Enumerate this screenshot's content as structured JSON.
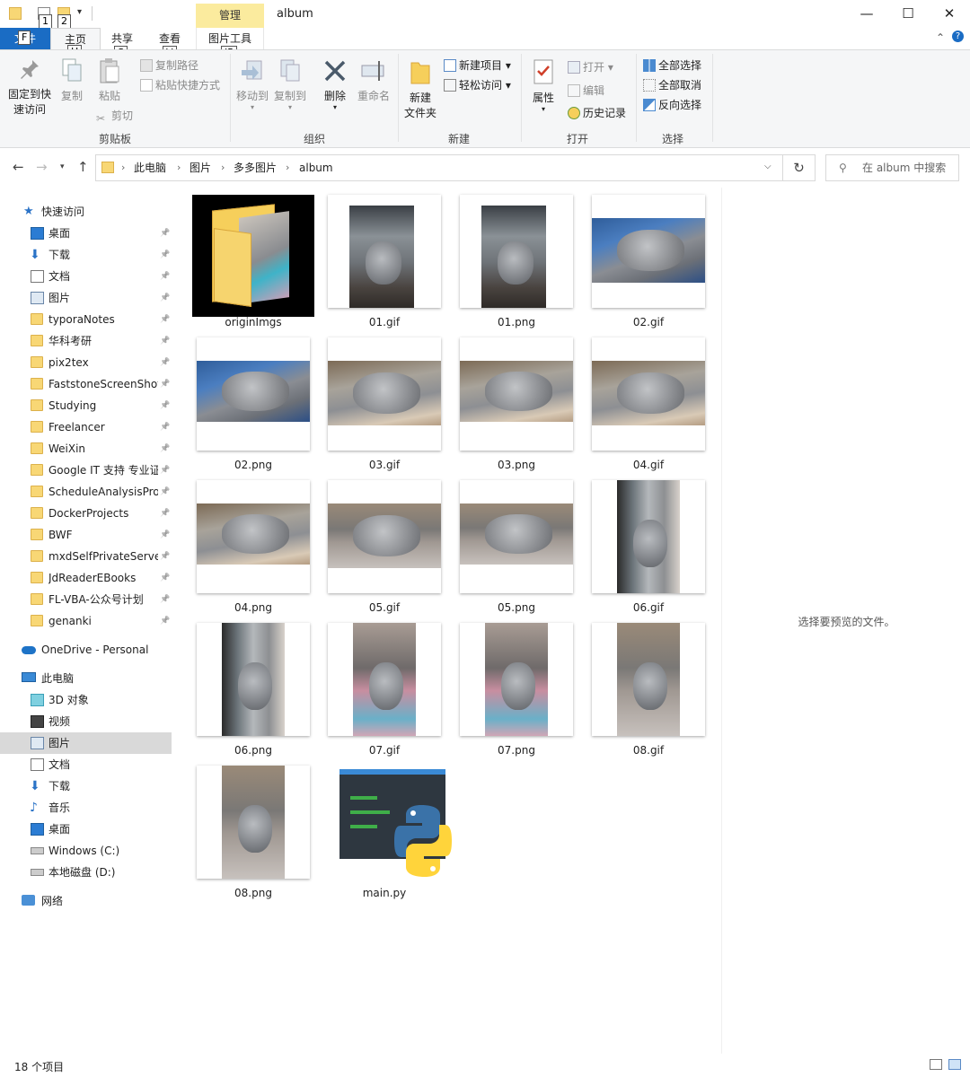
{
  "titlebar": {
    "keytips": [
      "1",
      "2",
      "F",
      "H",
      "S",
      "V",
      "JP"
    ],
    "context_tab": "管理",
    "title": "album",
    "minimize": "—",
    "maximize": "☐",
    "close": "✕"
  },
  "tabs": {
    "file": "文件",
    "home": "主页",
    "share": "共享",
    "view": "查看",
    "picture_tools": "图片工具"
  },
  "ribbon": {
    "clipboard": {
      "label": "剪贴板",
      "pin": "固定到快\n速访问",
      "copy": "复制",
      "paste": "粘贴",
      "copy_path": "复制路径",
      "paste_shortcut": "粘贴快捷方式",
      "cut": "剪切"
    },
    "organize": {
      "label": "组织",
      "move_to": "移动到",
      "copy_to": "复制到",
      "delete": "删除",
      "rename": "重命名"
    },
    "new": {
      "label": "新建",
      "new_folder": "新建\n文件夹",
      "new_item": "新建项目 ▾",
      "easy_access": "轻松访问 ▾"
    },
    "open": {
      "label": "打开",
      "properties": "属性",
      "open": "打开 ▾",
      "edit": "编辑",
      "history": "历史记录"
    },
    "select": {
      "label": "选择",
      "select_all": "全部选择",
      "select_none": "全部取消",
      "invert": "反向选择"
    }
  },
  "address": {
    "crumbs": [
      "此电脑",
      "图片",
      "多多图片",
      "album"
    ],
    "search_placeholder": "在 album 中搜索"
  },
  "sidebar": {
    "quick_access": "快速访问",
    "quick_items": [
      "桌面",
      "下载",
      "文档",
      "图片",
      "typoraNotes",
      "华科考研",
      "pix2tex",
      "FaststoneScreenShot",
      "Studying",
      "Freelancer",
      "WeiXin",
      "Google IT 支持 专业证书",
      "ScheduleAnalysisProject",
      "DockerProjects",
      "BWF",
      "mxdSelfPrivateServer",
      "JdReaderEBooks",
      "FL-VBA-公众号计划",
      "genanki"
    ],
    "onedrive": "OneDrive - Personal",
    "this_pc": "此电脑",
    "pc_items": [
      "3D 对象",
      "视频",
      "图片",
      "文档",
      "下载",
      "音乐",
      "桌面",
      "Windows (C:)",
      "本地磁盘 (D:)"
    ],
    "network": "网络"
  },
  "files": [
    "originImgs",
    "01.gif",
    "01.png",
    "02.gif",
    "02.png",
    "03.gif",
    "03.png",
    "04.gif",
    "04.png",
    "05.gif",
    "05.png",
    "06.gif",
    "06.png",
    "07.gif",
    "07.png",
    "08.gif",
    "08.png",
    "main.py"
  ],
  "preview": {
    "message": "选择要预览的文件。"
  },
  "status": {
    "count": "18 个项目"
  },
  "colors": {
    "file_tab": "#1a6cc4",
    "context_tab": "#fbeb9e",
    "selection": "#d9d9d9",
    "folder": "#f8d775"
  }
}
